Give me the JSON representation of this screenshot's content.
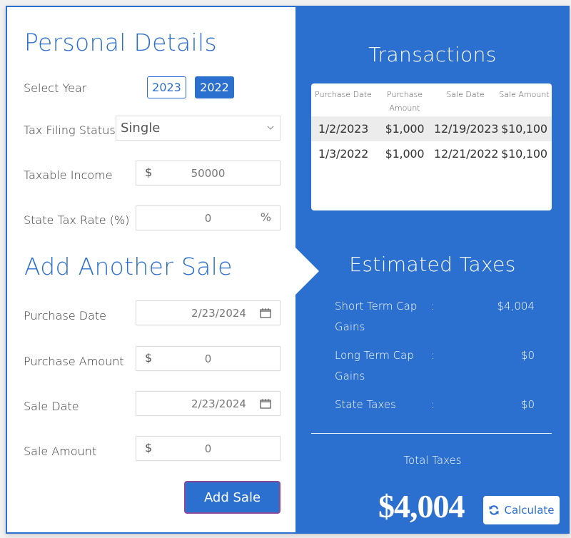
{
  "personal_details": {
    "title": "Personal Details",
    "select_year_label": "Select Year",
    "years": [
      {
        "label": "2023",
        "selected": false
      },
      {
        "label": "2022",
        "selected": true
      }
    ],
    "filing_status_label": "Tax Filing Status",
    "filing_status_value": "Single",
    "taxable_income_label": "Taxable Income",
    "taxable_income_prefix": "$",
    "taxable_income_value": "50000",
    "state_tax_rate_label": "State Tax Rate (%)",
    "state_tax_rate_value": "0",
    "state_tax_rate_suffix": "%"
  },
  "add_sale": {
    "title": "Add Another Sale",
    "purchase_date_label": "Purchase Date",
    "purchase_date_value": "2/23/2024",
    "purchase_amount_label": "Purchase Amount",
    "purchase_amount_prefix": "$",
    "purchase_amount_value": "0",
    "sale_date_label": "Sale Date",
    "sale_date_value": "2/23/2024",
    "sale_amount_label": "Sale Amount",
    "sale_amount_prefix": "$",
    "sale_amount_value": "0",
    "button_label": "Add Sale"
  },
  "transactions": {
    "title": "Transactions",
    "columns": [
      "Purchase Date",
      "Purchase Amount",
      "Sale Date",
      "Sale Amount"
    ],
    "rows": [
      [
        "1/2/2023",
        "$1,000",
        "12/19/2023",
        "$10,100"
      ],
      [
        "1/3/2022",
        "$1,000",
        "12/21/2022",
        "$10,100"
      ]
    ]
  },
  "estimated_taxes": {
    "title": "Estimated Taxes",
    "separator": ":",
    "items": [
      {
        "label": "Short Term Cap Gains",
        "amount": "$4,004"
      },
      {
        "label": "Long Term Cap Gains",
        "amount": "$0"
      },
      {
        "label": "State Taxes",
        "amount": "$0"
      }
    ],
    "total_label": "Total Taxes",
    "total_value": "$4,004",
    "calculate_label": "Calculate"
  },
  "colors": {
    "accent": "#2b6fcf",
    "panel_bg": "#2b6fcf",
    "row_shade": "#ececec",
    "button_border": "#8a4b9a"
  }
}
